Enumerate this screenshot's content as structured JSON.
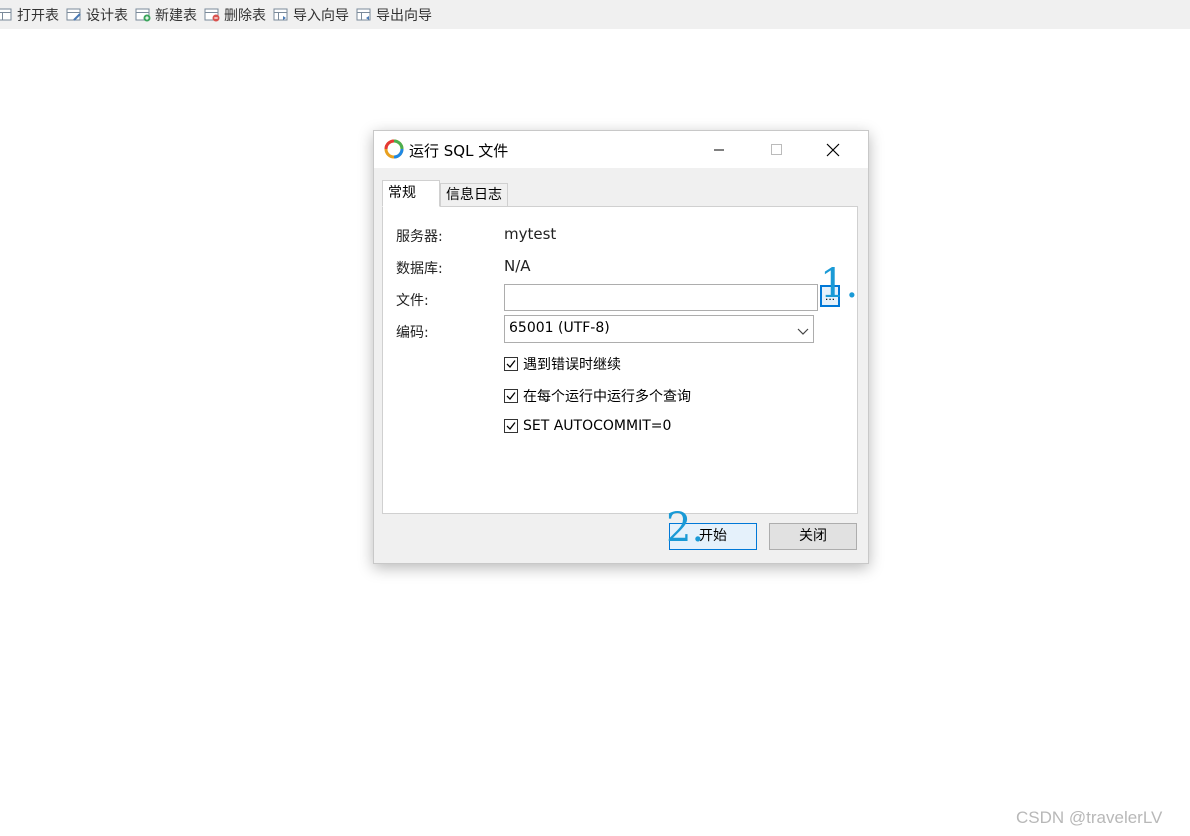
{
  "toolbar": {
    "items": [
      {
        "label": "打开表",
        "icon": "open-table-icon"
      },
      {
        "label": "设计表",
        "icon": "design-table-icon"
      },
      {
        "label": "新建表",
        "icon": "new-table-icon"
      },
      {
        "label": "删除表",
        "icon": "delete-table-icon"
      },
      {
        "label": "导入向导",
        "icon": "import-wizard-icon"
      },
      {
        "label": "导出向导",
        "icon": "export-wizard-icon"
      }
    ]
  },
  "dialog": {
    "title": "运行 SQL 文件",
    "tabs": [
      {
        "label": "常规",
        "active": true
      },
      {
        "label": "信息日志",
        "active": false
      }
    ],
    "fields": {
      "server_label": "服务器:",
      "server_value": "mytest",
      "database_label": "数据库:",
      "database_value": "N/A",
      "file_label": "文件:",
      "file_value": "",
      "browse_label": "...",
      "encoding_label": "编码:",
      "encoding_value": "65001 (UTF-8)"
    },
    "options": [
      {
        "label": "遇到错误时继续",
        "checked": true
      },
      {
        "label": "在每个运行中运行多个查询",
        "checked": true
      },
      {
        "label": "SET AUTOCOMMIT=0",
        "checked": true
      }
    ],
    "buttons": {
      "start": "开始",
      "close": "关闭"
    }
  },
  "annotations": {
    "step1": "1.",
    "step2": "2."
  },
  "watermark": "CSDN @travelerLV",
  "colors": {
    "accent": "#0078d7",
    "annotation": "#1a9ad6",
    "toolbar_bg": "#f0f0f0"
  }
}
